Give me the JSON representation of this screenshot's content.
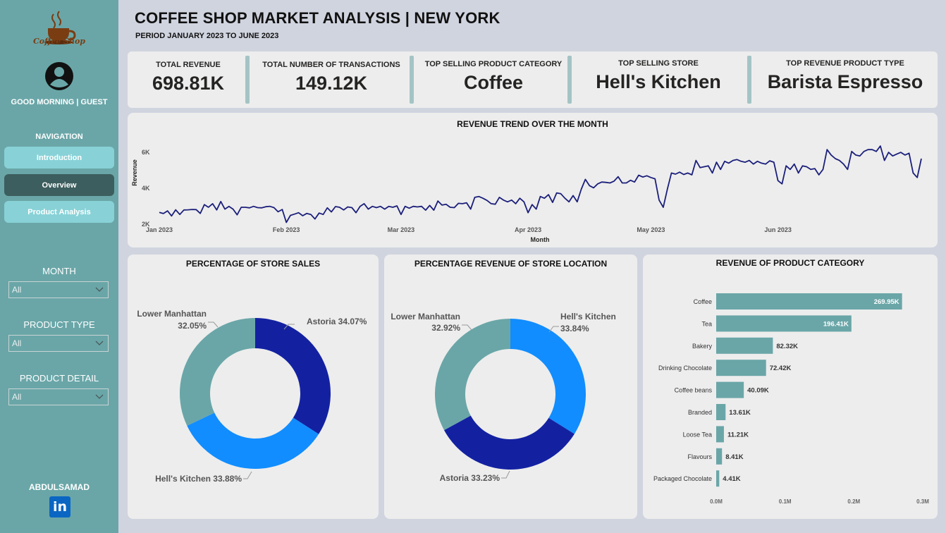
{
  "sidebar": {
    "logo_text": "Coffee Shop",
    "greeting": "GOOD MORNING | GUEST",
    "nav_title": "NAVIGATION",
    "nav": [
      {
        "label": "Introduction"
      },
      {
        "label": "Overview"
      },
      {
        "label": "Product Analysis"
      }
    ],
    "filters": [
      {
        "label": "MONTH",
        "value": "All"
      },
      {
        "label": "PRODUCT TYPE",
        "value": "All"
      },
      {
        "label": "PRODUCT DETAIL",
        "value": "All"
      }
    ],
    "author": "ABDULSAMAD",
    "linkedin_label": "in"
  },
  "header": {
    "title": "COFFEE SHOP MARKET ANALYSIS | NEW YORK",
    "subtitle": "PERIOD JANUARY 2023 TO JUNE 2023"
  },
  "kpis": [
    {
      "label": "TOTAL REVENUE",
      "value": "698.81K"
    },
    {
      "label": "TOTAL NUMBER OF TRANSACTIONS",
      "value": "149.12K"
    },
    {
      "label": "TOP SELLING PRODUCT CATEGORY",
      "value": "Coffee"
    },
    {
      "label": "TOP SELLING STORE",
      "value": "Hell's Kitchen"
    },
    {
      "label": "TOP REVENUE PRODUCT TYPE",
      "value": "Barista Espresso"
    }
  ],
  "colors": {
    "sidebar": "#6aa6a8",
    "accent_teal": "#6aa6a8",
    "line": "#1b1f7a",
    "dark_blue": "#1321a1",
    "bright_blue": "#118dff",
    "bar": "#6aa6a8"
  },
  "chart_data": [
    {
      "type": "line",
      "title": "REVENUE TREND OVER THE MONTH",
      "xlabel": "Month",
      "ylabel": "Revenue",
      "x_ticks": [
        "Jan 2023",
        "Feb 2023",
        "Mar 2023",
        "Apr 2023",
        "May 2023",
        "Jun 2023"
      ],
      "y_ticks": [
        "2K",
        "4K",
        "6K"
      ],
      "ylim": [
        2000,
        6500
      ],
      "x_start": "2023-01-01",
      "series": [
        {
          "values": [
            2620,
            2550,
            2700,
            2420,
            2760,
            2500,
            2750,
            2760,
            2780,
            2770,
            2560,
            3050,
            2900,
            3100,
            2750,
            3220,
            2800,
            2950,
            2800,
            2480,
            2900,
            2900,
            2870,
            2950,
            2880,
            2870,
            2930,
            2950,
            2880,
            2650,
            2780,
            2060,
            2450,
            2520,
            2600,
            2430,
            2560,
            2500,
            2250,
            2580,
            2500,
            2870,
            2640,
            2940,
            2900,
            2750,
            2920,
            2880,
            2600,
            2950,
            3100,
            2800,
            2950,
            2880,
            2950,
            2800,
            2950,
            2900,
            2980,
            2500,
            2950,
            2850,
            2950,
            2920,
            2950,
            2740,
            3000,
            2740,
            3250,
            3020,
            3070,
            2900,
            2880,
            3120,
            3100,
            3150,
            2800,
            3450,
            3500,
            3400,
            3280,
            3100,
            3070,
            3450,
            3300,
            3200,
            3300,
            3100,
            3400,
            3200,
            2600,
            3050,
            2800,
            3500,
            3400,
            3600,
            3170,
            3700,
            3650,
            3400,
            3200,
            3550,
            3200,
            3900,
            4450,
            4100,
            3980,
            4200,
            4300,
            4280,
            4250,
            4350,
            4600,
            4250,
            4250,
            4400,
            4300,
            4680,
            4580,
            4650,
            4550,
            4480,
            3300,
            2900,
            3900,
            4800,
            4740,
            4850,
            4720,
            4800,
            4700,
            5500,
            5100,
            5150,
            5200,
            4800,
            5400,
            5000,
            5450,
            5350,
            5500,
            5550,
            5450,
            5400,
            5500,
            5300,
            5450,
            5350,
            5300,
            5480,
            5400,
            4380,
            4200,
            5200,
            5000,
            5300,
            4800,
            5200,
            5150,
            5000,
            5050,
            4700,
            5000,
            6100,
            5800,
            5600,
            5500,
            5300,
            5000,
            6000,
            5800,
            5750,
            6000,
            6100,
            6100,
            6000,
            6300,
            5500,
            5950,
            5750,
            5850,
            5950,
            5800,
            5900,
            4800,
            4550,
            5600
          ]
        }
      ]
    },
    {
      "type": "pie",
      "title": "PERCENTAGE OF STORE SALES",
      "labels": [
        "Astoria",
        "Hell's Kitchen",
        "Lower Manhattan"
      ],
      "values": [
        34.07,
        33.88,
        32.05
      ],
      "label_texts": [
        "Astoria 34.07%",
        "Hell's Kitchen 33.88%",
        "Lower Manhattan",
        "32.05%"
      ],
      "colors": [
        "#1321a1",
        "#118dff",
        "#6aa6a8"
      ]
    },
    {
      "type": "pie",
      "title": "PERCENTAGE REVENUE OF STORE LOCATION",
      "labels": [
        "Hell's Kitchen",
        "Astoria",
        "Lower Manhattan"
      ],
      "values": [
        33.84,
        33.23,
        32.92
      ],
      "label_texts": [
        "Hell's Kitchen",
        "33.84%",
        "Astoria 33.23%",
        "Lower Manhattan",
        "32.92%"
      ],
      "colors": [
        "#118dff",
        "#1321a1",
        "#6aa6a8"
      ]
    },
    {
      "type": "bar",
      "orientation": "horizontal",
      "title": "REVENUE OF PRODUCT CATEGORY",
      "categories": [
        "Coffee",
        "Tea",
        "Bakery",
        "Drinking Chocolate",
        "Coffee beans",
        "Branded",
        "Loose Tea",
        "Flavours",
        "Packaged Chocolate"
      ],
      "values": [
        269950,
        196410,
        82320,
        72420,
        40090,
        13610,
        11210,
        8410,
        4410
      ],
      "value_labels": [
        "269.95K",
        "196.41K",
        "82.32K",
        "72.42K",
        "40.09K",
        "13.61K",
        "11.21K",
        "8.41K",
        "4.41K"
      ],
      "x_ticks": [
        "0.0M",
        "0.1M",
        "0.2M",
        "0.3M"
      ],
      "xlim": [
        0,
        300000
      ]
    }
  ]
}
